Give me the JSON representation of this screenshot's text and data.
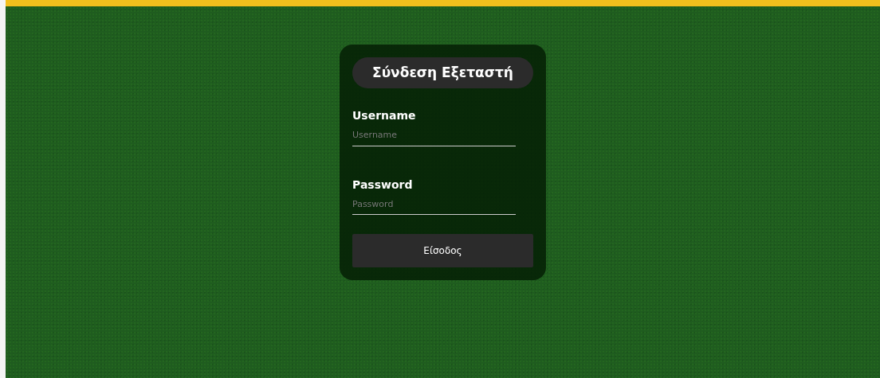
{
  "title": "Σύνδεση Εξεταστή",
  "fields": [
    {
      "label": "Username",
      "placeholder": "Username"
    },
    {
      "label": "Password",
      "placeholder": "Password"
    }
  ],
  "button": "Είσοδος"
}
